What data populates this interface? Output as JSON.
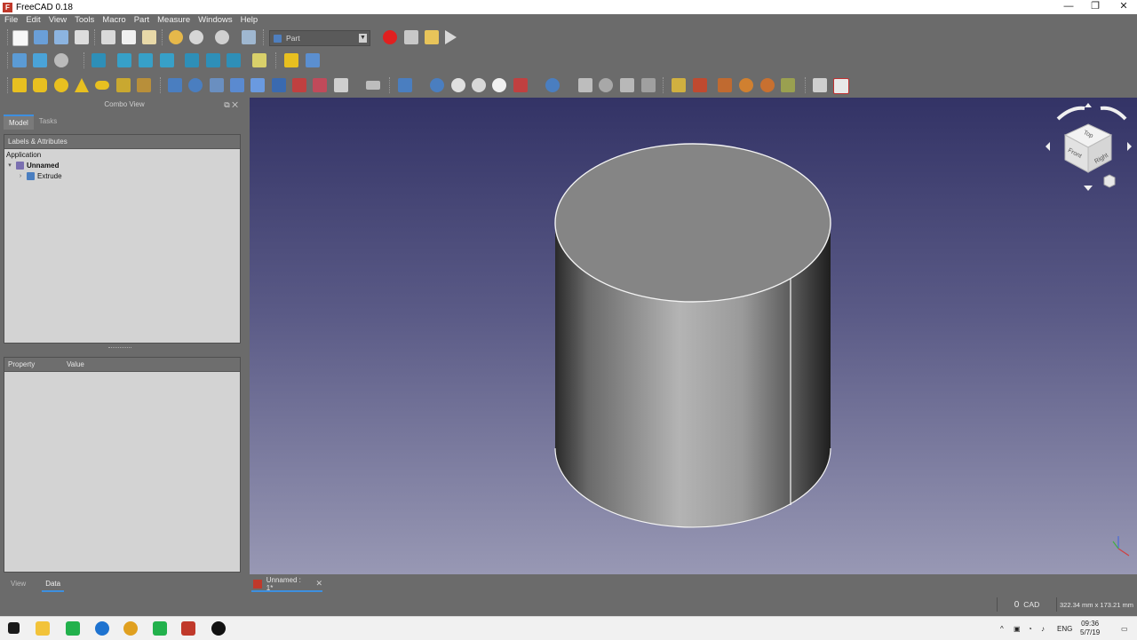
{
  "window": {
    "title": "FreeCAD 0.18",
    "minimize": "—",
    "maximize": "❐",
    "close": "✕"
  },
  "menu": [
    "File",
    "Edit",
    "View",
    "Tools",
    "Macro",
    "Part",
    "Measure",
    "Windows",
    "Help"
  ],
  "workbench_selector": {
    "value": "Part"
  },
  "combo_view": {
    "title": "Combo View",
    "tabs": [
      "Model",
      "Tasks"
    ],
    "tree_header": "Labels & Attributes",
    "tree_root": "Application",
    "document": "Unnamed",
    "object": "Extrude",
    "property_columns": [
      "Property",
      "Value"
    ],
    "bottom_tabs": [
      "View",
      "Data"
    ]
  },
  "document_tab": {
    "label": "Unnamed : 1*",
    "close": "✕"
  },
  "navicube": {
    "top": "Top",
    "front": "Front",
    "right": "Right"
  },
  "statusbar": {
    "nav_style": "CAD",
    "nav_icon": "0",
    "dimensions": "322.34 mm x 173.21 mm"
  },
  "taskbar": {
    "language": "ENG",
    "time": "09:36",
    "date": "5/7/19"
  },
  "colors": {
    "accent": "#3d8fe0",
    "viewport_top": "#333366",
    "viewport_bottom": "#9898b4",
    "macro_record": "#e02020"
  }
}
